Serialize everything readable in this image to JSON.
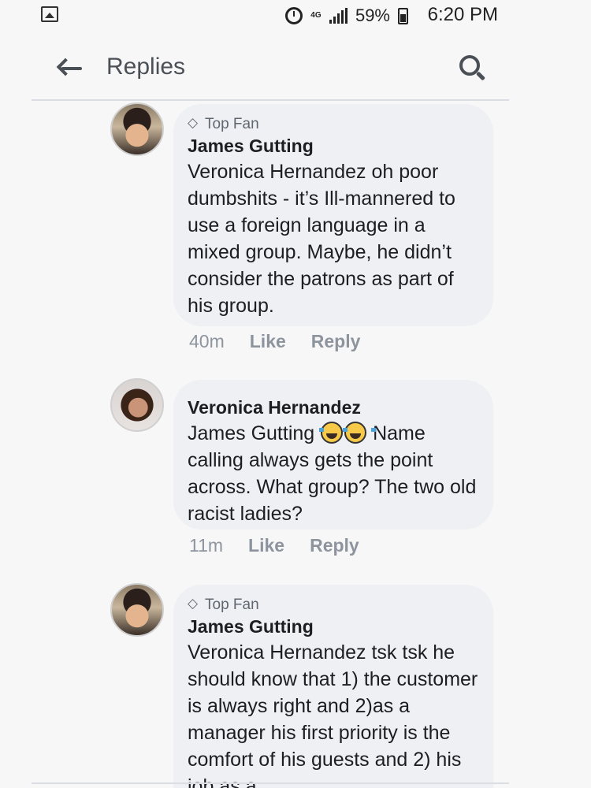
{
  "status_bar": {
    "network": "4G",
    "battery": "59%",
    "time": "6:20 PM"
  },
  "header": {
    "back_icon": "arrow-left-icon",
    "title": "Replies",
    "search_icon": "search-icon"
  },
  "comments": [
    {
      "badge": "Top Fan",
      "author": "James Gutting",
      "text": "Veronica Hernandez oh poor dumbshits - it’s Ill-mannered to use a foreign language in a mixed group.  Maybe, he didn’t consider the patrons as part of his group.",
      "time": "40m",
      "like": "Like",
      "reply": "Reply"
    },
    {
      "badge": "",
      "author": "Veronica Hernandez",
      "text_prefix": "James Gutting",
      "emojis": [
        "face-with-tears-of-joy",
        "face-with-tears-of-joy"
      ],
      "text_suffix": " Name calling always gets the point across. What group? The two old racist ladies?",
      "time": "11m",
      "like": "Like",
      "reply": "Reply"
    },
    {
      "badge": "Top Fan",
      "author": "James Gutting",
      "text": "Veronica Hernandez tsk tsk he should know that 1) the customer is always right and 2)as a manager his first priority is the comfort of his guests and 2) his job as a",
      "time": "",
      "like": "",
      "reply": ""
    }
  ]
}
